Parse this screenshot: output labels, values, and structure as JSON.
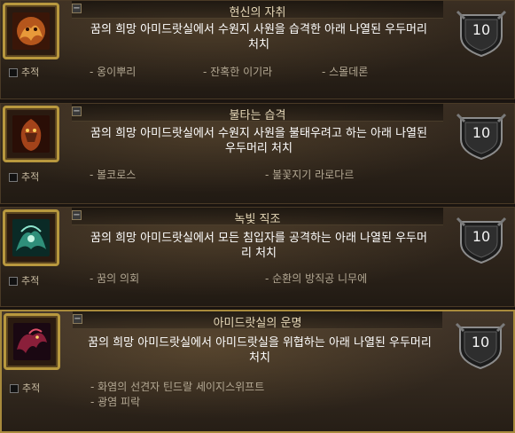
{
  "achievements": [
    {
      "title": "현신의 자취",
      "description": "꿈의 희망 아미드랏실에서 수원지 사원을 습격한 아래 나열된 우두머리 처치",
      "criteria": [
        "- 옹이뿌리",
        "- 잔혹한 이기라",
        "- 스몰데론"
      ],
      "points": "10",
      "track_label": "추적",
      "colors": {
        "emblem": "#b5561c"
      }
    },
    {
      "title": "불타는 습격",
      "description": "꿈의 희망 아미드랏실에서 수원지 사원을 불태우려고 하는 아래 나열된 우두머리 처치",
      "criteria": [
        "- 볼코로스",
        "- 불꽃지기 라로다르"
      ],
      "points": "10",
      "track_label": "추적",
      "colors": {
        "emblem": "#a3431a"
      }
    },
    {
      "title": "녹빛 직조",
      "description": "꿈의 희망 아미드랏실에서 모든 침입자를 공격하는 아래 나열된 우두머리 처치",
      "criteria": [
        "- 꿈의 의회",
        "- 순환의 방직공 니무에"
      ],
      "points": "10",
      "track_label": "추적",
      "colors": {
        "emblem": "#2f8f7a"
      }
    },
    {
      "title": "아미드랏실의 운명",
      "description": "꿈의 희망 아미드랏실에서 아미드랏실을 위협하는 아래 나열된 우두머리 처치",
      "criteria": [
        "- 화염의 선견자 틴드랄 세이지스위프트",
        "- 광염 피락"
      ],
      "points": "10",
      "track_label": "추적",
      "colors": {
        "emblem": "#8a1f3a"
      }
    }
  ]
}
